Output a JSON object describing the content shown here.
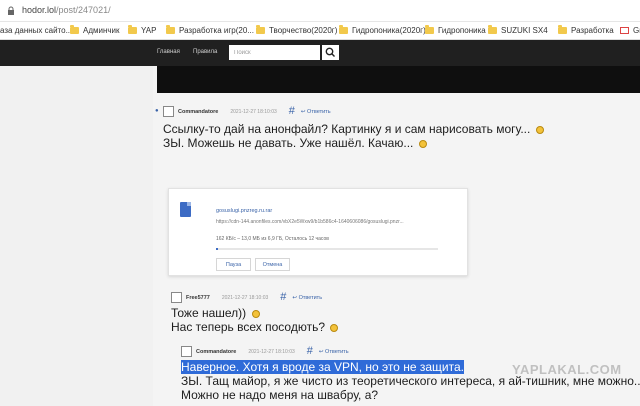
{
  "browser": {
    "url_host": "hodor.lol",
    "url_path": "/post/247021/",
    "bookmarks": [
      {
        "label": "аза данных сайто...",
        "icon": "page"
      },
      {
        "label": "Админчик",
        "icon": "folder"
      },
      {
        "label": "YAP",
        "icon": "folder"
      },
      {
        "label": "Разработка игр(20...",
        "icon": "folder"
      },
      {
        "label": "Творчество(2020г)",
        "icon": "folder"
      },
      {
        "label": "Гидропоника(2020г)",
        "icon": "folder"
      },
      {
        "label": "Гидропоника",
        "icon": "folder"
      },
      {
        "label": "SUZUKI SX4",
        "icon": "folder"
      },
      {
        "label": "Разработка",
        "icon": "folder"
      },
      {
        "label": "Gm",
        "icon": "gmail"
      }
    ]
  },
  "site": {
    "nav": [
      "Главная",
      "Правила"
    ],
    "search_placeholder": "Поиск"
  },
  "comments": [
    {
      "author": "Commandatore",
      "date": "2021-12-27 18:10:03",
      "hash": "#",
      "reply": "Ответить",
      "lines": [
        "Ссылку-то дай на анонфайл? Картинку я и сам нарисовать могу...",
        "ЗЫ. Можешь не давать. Уже нашёл. Качаю..."
      ]
    },
    {
      "author": "Free5777",
      "date": "2021-12-27 18:10:03",
      "hash": "#",
      "reply": "Ответить",
      "lines": [
        "Тоже нашел))",
        "Нас теперь всех посодють?"
      ]
    },
    {
      "author": "Commandatore",
      "date": "2021-12-27 18:10:03",
      "hash": "#",
      "reply": "Ответить",
      "lines": [
        "Наверное. Хотя я вроде за VPN, но это не защита.",
        "ЗЫ. Тащ майор, я же чисто из теоретического интереса, я ай-тишник, мне можно...",
        "Можно не надо меня на швабру, а?"
      ]
    }
  ],
  "download": {
    "filename": "gosuslugi.pnzreg.ru.rar",
    "url": "https://cdn-144.anonfiles.com/vbX2e5Wxw9/b1b586c4-1640606086/gosuslugi.pnzr...",
    "progress_text": "162 КБ/с – 13,0 МБ из 6,9 ГБ, Осталось 12 часов",
    "progress": 0.002,
    "pause": "Пауза",
    "cancel": "Отмена"
  },
  "watermark": "YAPLAKAL.COM"
}
